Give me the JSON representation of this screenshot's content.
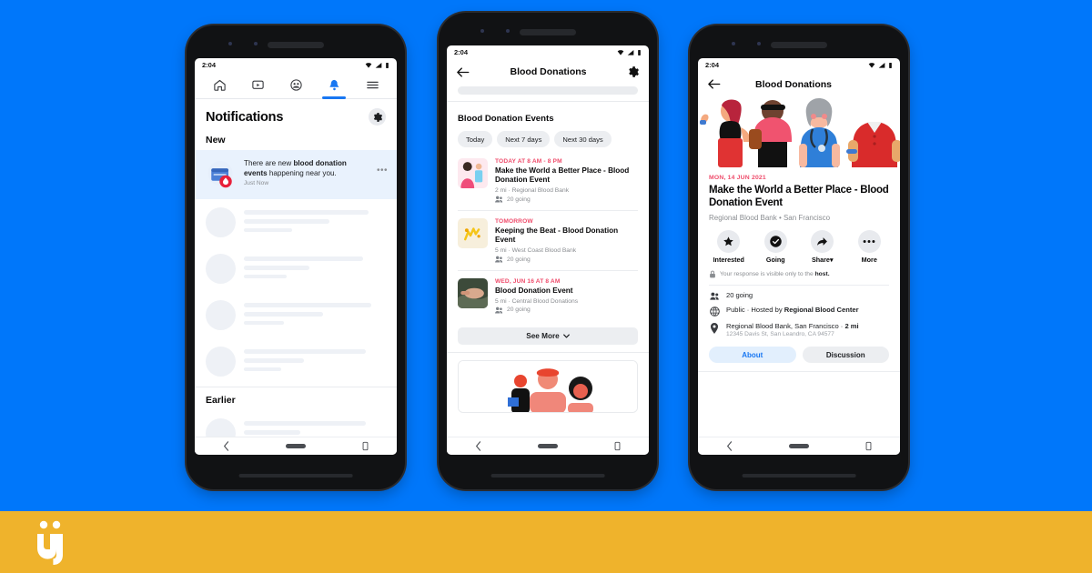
{
  "background_color": "#0077fa",
  "brand_bar": {
    "color": "#efb32c",
    "logo_name": "arabic-letter-logo"
  },
  "status_bar": {
    "time": "2:04",
    "icons": [
      "wifi-icon",
      "signal-icon",
      "battery-icon"
    ]
  },
  "phone1": {
    "nav_tabs": [
      {
        "name": "home-tab",
        "icon": "home-icon",
        "active": false
      },
      {
        "name": "watch-tab",
        "icon": "video-icon",
        "active": false
      },
      {
        "name": "groups-tab",
        "icon": "groups-icon",
        "active": false
      },
      {
        "name": "notifications-tab",
        "icon": "bell-icon",
        "active": true
      },
      {
        "name": "menu-tab",
        "icon": "hamburger-menu-icon",
        "active": false
      }
    ],
    "page_title": "Notifications",
    "settings_icon": "gear-icon",
    "section_new": "New",
    "section_earlier": "Earlier",
    "notification": {
      "text_prefix": "There are new ",
      "text_bold": "blood donation events",
      "text_suffix": " happening near you.",
      "time": "Just Now",
      "icon": "calendar-blood-drop-icon",
      "more_icon": "ellipsis-icon"
    }
  },
  "phone2": {
    "header_title": "Blood Donations",
    "back_icon": "back-arrow-icon",
    "settings_icon": "gear-icon",
    "list_title": "Blood Donation Events",
    "chips": [
      "Today",
      "Next 7 days",
      "Next 30 days"
    ],
    "events": [
      {
        "when": "TODAY AT 8 AM - 8 PM",
        "name": "Make the World a Better Place - Blood Donation Event",
        "meta": "2 mi · Regional Blood Bank",
        "going": "20 going",
        "thumb": "pink-illustration-thumbnail"
      },
      {
        "when": "TOMORROW",
        "name": "Keeping the Beat - Blood Donation Event",
        "meta": "5 mi · West Coast Blood Bank",
        "going": "20 going",
        "thumb": "cream-illustration-thumbnail"
      },
      {
        "when": "WED, JUN 16 AT 8 AM",
        "name": "Blood Donation Event",
        "meta": "5 mi · Central Blood Donations",
        "going": "20 going",
        "thumb": "photo-thumbnail"
      }
    ],
    "see_more": "See More",
    "see_more_icon": "chevron-down-icon"
  },
  "phone3": {
    "header_title": "Blood Donations",
    "back_icon": "back-arrow-icon",
    "hero_image": "blood-donors-illustration",
    "date": "MON, 14 JUN 2021",
    "title": "Make the World a Better Place - Blood Donation Event",
    "subtitle": "Regional Blood Bank • San Francisco",
    "actions": [
      {
        "label": "Interested",
        "icon": "star-icon"
      },
      {
        "label": "Going",
        "icon": "check-circle-icon"
      },
      {
        "label": "Share",
        "icon": "share-arrow-icon",
        "caret": "▾"
      },
      {
        "label": "More",
        "icon": "ellipsis-icon"
      }
    ],
    "privacy_icon": "lock-icon",
    "privacy_prefix": "Your response is visible only to the ",
    "privacy_bold": "host.",
    "info": [
      {
        "icon": "people-icon",
        "text": "20 going"
      },
      {
        "icon": "globe-icon",
        "prefix": "Public · Hosted by ",
        "bold": "Regional Blood Center"
      },
      {
        "icon": "location-pin-icon",
        "prefix": "Regional Blood Bank, San Francisco · ",
        "bold": "2 mi",
        "sub": "12345 Davis St, San Leandro, CA 94577"
      }
    ],
    "tabs": [
      {
        "label": "About",
        "selected": true
      },
      {
        "label": "Discussion",
        "selected": false
      }
    ]
  },
  "android_nav": {
    "back": "back-chevron-icon",
    "home": "home-pill-icon",
    "recents": "recents-icon"
  }
}
